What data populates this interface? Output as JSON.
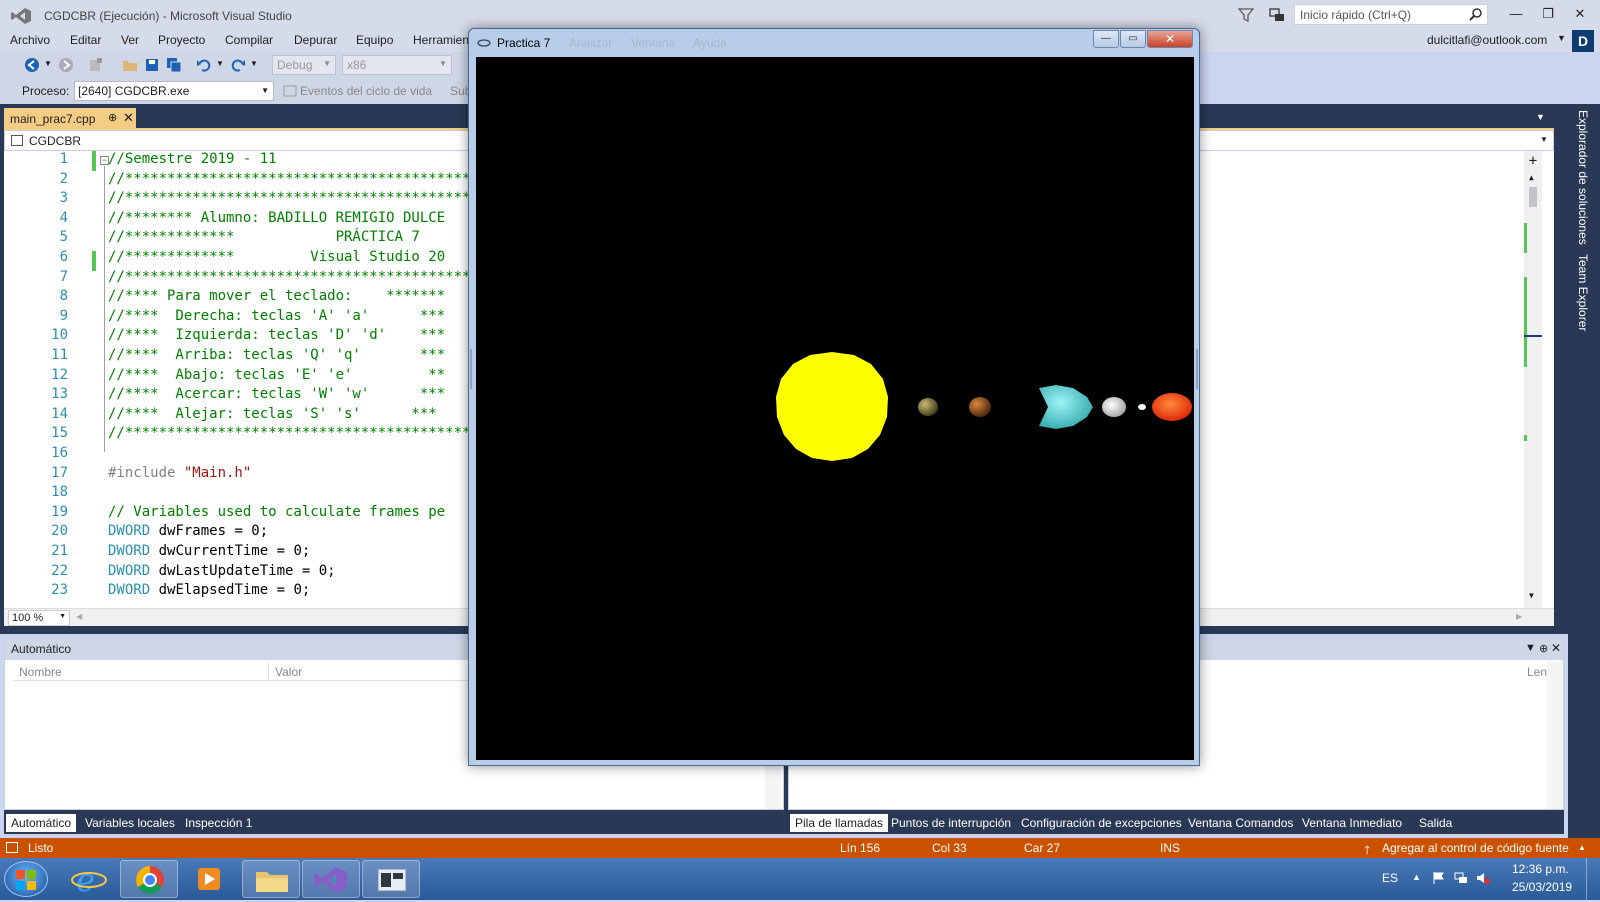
{
  "vs": {
    "title": "CGDCBR (Ejecución) - Microsoft Visual Studio",
    "quick_search_placeholder": "Inicio rápido (Ctrl+Q)",
    "menu": [
      "Archivo",
      "Editar",
      "Ver",
      "Proyecto",
      "Compilar",
      "Depurar",
      "Equipo",
      "Herramien"
    ],
    "account": "dulcitlafi@outlook.com",
    "avatar_letter": "D",
    "toolbar": {
      "config": "Debug",
      "platform": "x86"
    },
    "process_label": "Proceso:",
    "process_value": "[2640] CGDCBR.exe",
    "events_label": "Eventos del ciclo de vida",
    "sub_label": "Sub"
  },
  "editor": {
    "tab_name": "main_prac7.cpp",
    "tab_pin": "⊕",
    "tab_close": "✕",
    "project": "CGDCBR",
    "zoom": "100 %",
    "lines": [
      {
        "n": "1",
        "segs": [
          {
            "t": "//Semestre 2019 - 11",
            "c": "green"
          }
        ]
      },
      {
        "n": "2",
        "segs": [
          {
            "t": "//************************************************",
            "c": "green"
          }
        ]
      },
      {
        "n": "3",
        "segs": [
          {
            "t": "//************************************************",
            "c": "green"
          }
        ]
      },
      {
        "n": "4",
        "segs": [
          {
            "t": "//******** Alumno: BADILLO REMIGIO DULCE",
            "c": "green"
          }
        ]
      },
      {
        "n": "5",
        "segs": [
          {
            "t": "//*************            PRÁCTICA 7",
            "c": "green"
          }
        ]
      },
      {
        "n": "6",
        "segs": [
          {
            "t": "//*************         Visual Studio 20",
            "c": "green"
          }
        ]
      },
      {
        "n": "7",
        "segs": [
          {
            "t": "//************************************************",
            "c": "green"
          }
        ]
      },
      {
        "n": "8",
        "segs": [
          {
            "t": "//**** Para mover el teclado:    *******",
            "c": "green"
          }
        ]
      },
      {
        "n": "9",
        "segs": [
          {
            "t": "//****  Derecha: teclas 'A' 'a'      ***",
            "c": "green"
          }
        ]
      },
      {
        "n": "10",
        "segs": [
          {
            "t": "//****  Izquierda: teclas 'D' 'd'    ***",
            "c": "green"
          }
        ]
      },
      {
        "n": "11",
        "segs": [
          {
            "t": "//****  Arriba: teclas 'Q' 'q'       ***",
            "c": "green"
          }
        ]
      },
      {
        "n": "12",
        "segs": [
          {
            "t": "//****  Abajo: teclas 'E' 'e'         **",
            "c": "green"
          }
        ]
      },
      {
        "n": "13",
        "segs": [
          {
            "t": "//****  Acercar: teclas 'W' 'w'      ***",
            "c": "green"
          }
        ]
      },
      {
        "n": "14",
        "segs": [
          {
            "t": "//****  Alejar: teclas 'S' 's'      ***",
            "c": "green"
          }
        ]
      },
      {
        "n": "15",
        "segs": [
          {
            "t": "//************************************************",
            "c": "green"
          }
        ]
      },
      {
        "n": "16",
        "segs": []
      },
      {
        "n": "17",
        "segs": [
          {
            "t": "#include ",
            "c": "gray"
          },
          {
            "t": "\"Main.h\"",
            "c": "red"
          }
        ]
      },
      {
        "n": "18",
        "segs": []
      },
      {
        "n": "19",
        "segs": [
          {
            "t": "// Variables used to calculate frames pe",
            "c": "green"
          }
        ]
      },
      {
        "n": "20",
        "segs": [
          {
            "t": "DWORD",
            "c": "blue"
          },
          {
            "t": " dwFrames = 0;",
            "c": "black"
          }
        ]
      },
      {
        "n": "21",
        "segs": [
          {
            "t": "DWORD",
            "c": "blue"
          },
          {
            "t": " dwCurrentTime = 0;",
            "c": "black"
          }
        ]
      },
      {
        "n": "22",
        "segs": [
          {
            "t": "DWORD",
            "c": "blue"
          },
          {
            "t": " dwLastUpdateTime = 0;",
            "c": "black"
          }
        ]
      },
      {
        "n": "23",
        "segs": [
          {
            "t": "DWORD",
            "c": "blue"
          },
          {
            "t": " dwElapsedTime = 0;",
            "c": "black"
          }
        ]
      }
    ]
  },
  "autos": {
    "title": "Automático",
    "col_name": "Nombre",
    "col_value": "Valor",
    "col_lang": "Leng",
    "tabs": [
      "Automático",
      "Variables locales",
      "Inspección 1"
    ]
  },
  "callstack_tabs": [
    "Pila de llamadas",
    "Puntos de interrupción",
    "Configuración de excepciones",
    "Ventana Comandos",
    "Ventana Inmediato",
    "Salida"
  ],
  "side_tabs": [
    "Explorador de soluciones",
    "Team Explorer"
  ],
  "status": {
    "ready": "Listo",
    "line": "Lín 156",
    "col": "Col 33",
    "char": "Car 27",
    "mode": "INS",
    "source_control": "Agregar al control de código fuente"
  },
  "taskbar": {
    "lang": "ES",
    "time": "12:36 p.m.",
    "date": "25/03/2019"
  },
  "gl_window": {
    "title": "Practica 7",
    "ghost_menu": [
      "Analizar",
      "Ventana",
      "Ayuda"
    ],
    "minimize": "—",
    "maximize": "▭",
    "close": "✕",
    "bodies": [
      {
        "name": "sun",
        "color": "#ffff00"
      },
      {
        "name": "mercury",
        "color": "#8a7a3a"
      },
      {
        "name": "venus",
        "color": "#a0581e"
      },
      {
        "name": "earth",
        "color": "#5fd9d9"
      },
      {
        "name": "moon",
        "color": "#e8e8e8"
      },
      {
        "name": "small",
        "color": "#ffffff"
      },
      {
        "name": "mars",
        "color": "#ff3a00"
      }
    ]
  },
  "colors": {
    "vs_chrome": "#d6dbe9",
    "doc_well": "#293955",
    "tab_active": "#f5cc84",
    "status_bar": "#ca5100"
  }
}
